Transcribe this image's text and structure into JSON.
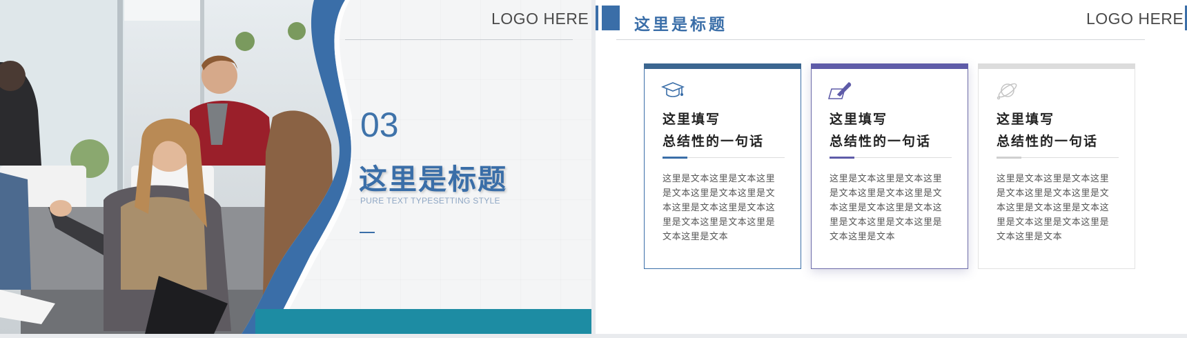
{
  "left_slide": {
    "logo": "LOGO HERE",
    "section_number": "03",
    "title": "这里是标题",
    "subtitle": "PURE TEXT TYPESETTING STYLE"
  },
  "right_slide": {
    "title": "这里是标题",
    "logo": "LOGO HERE",
    "cards": [
      {
        "icon": "graduation-cap-icon",
        "heading_line1": "这里填写",
        "heading_line2": "总结性的一句话",
        "body": "这里是文本这里是文本这里是文本这里是文本这里是文本这里是文本这里是文本这里是文本这里是文本这里是文本这里是文本"
      },
      {
        "icon": "pen-note-icon",
        "heading_line1": "这里填写",
        "heading_line2": "总结性的一句话",
        "body": "这里是文本这里是文本这里是文本这里是文本这里是文本这里是文本这里是文本这里是文本这里是文本这里是文本这里是文本"
      },
      {
        "icon": "planet-icon",
        "heading_line1": "这里填写",
        "heading_line2": "总结性的一句话",
        "body": "这里是文本这里是文本这里是文本这里是文本这里是文本这里是文本这里是文本这里是文本这里是文本这里是文本这里是文本"
      }
    ]
  },
  "colors": {
    "primary_blue": "#3a6ea8",
    "teal": "#1d8ca3",
    "purple": "#5e5ba8",
    "light_gray": "#dcdcdc"
  }
}
